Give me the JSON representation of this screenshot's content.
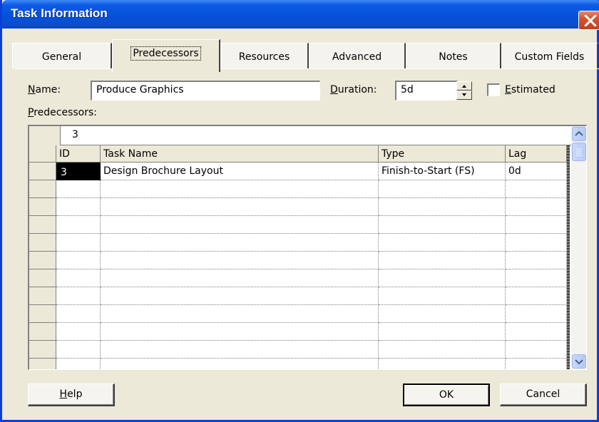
{
  "window": {
    "title": "Task Information"
  },
  "tabs": [
    {
      "label": "General"
    },
    {
      "label": "Predecessors"
    },
    {
      "label": "Resources"
    },
    {
      "label": "Advanced"
    },
    {
      "label": "Notes"
    },
    {
      "label": "Custom Fields"
    }
  ],
  "active_tab": "Predecessors",
  "form": {
    "name_label_u": "N",
    "name_label_rest": "ame:",
    "name_value": "Produce Graphics",
    "duration_label_u": "D",
    "duration_label_rest": "uration:",
    "duration_value": "5d",
    "estimated_label_u": "E",
    "estimated_label_rest": "stimated",
    "estimated_checked": false,
    "predecessors_label_u": "P",
    "predecessors_label_rest": "redecessors:"
  },
  "grid": {
    "edit_value": "3",
    "columns": [
      "ID",
      "Task Name",
      "Type",
      "Lag"
    ],
    "rows": [
      {
        "id": "3",
        "task_name": "Design Brochure Layout",
        "type": "Finish-to-Start (FS)",
        "lag": "0d"
      }
    ]
  },
  "buttons": {
    "help_u": "H",
    "help_rest": "elp",
    "ok": "OK",
    "cancel": "Cancel"
  },
  "colors": {
    "titlebar": "#0551d8",
    "close": "#d4542c",
    "dialog_bg": "#ece9d8"
  }
}
